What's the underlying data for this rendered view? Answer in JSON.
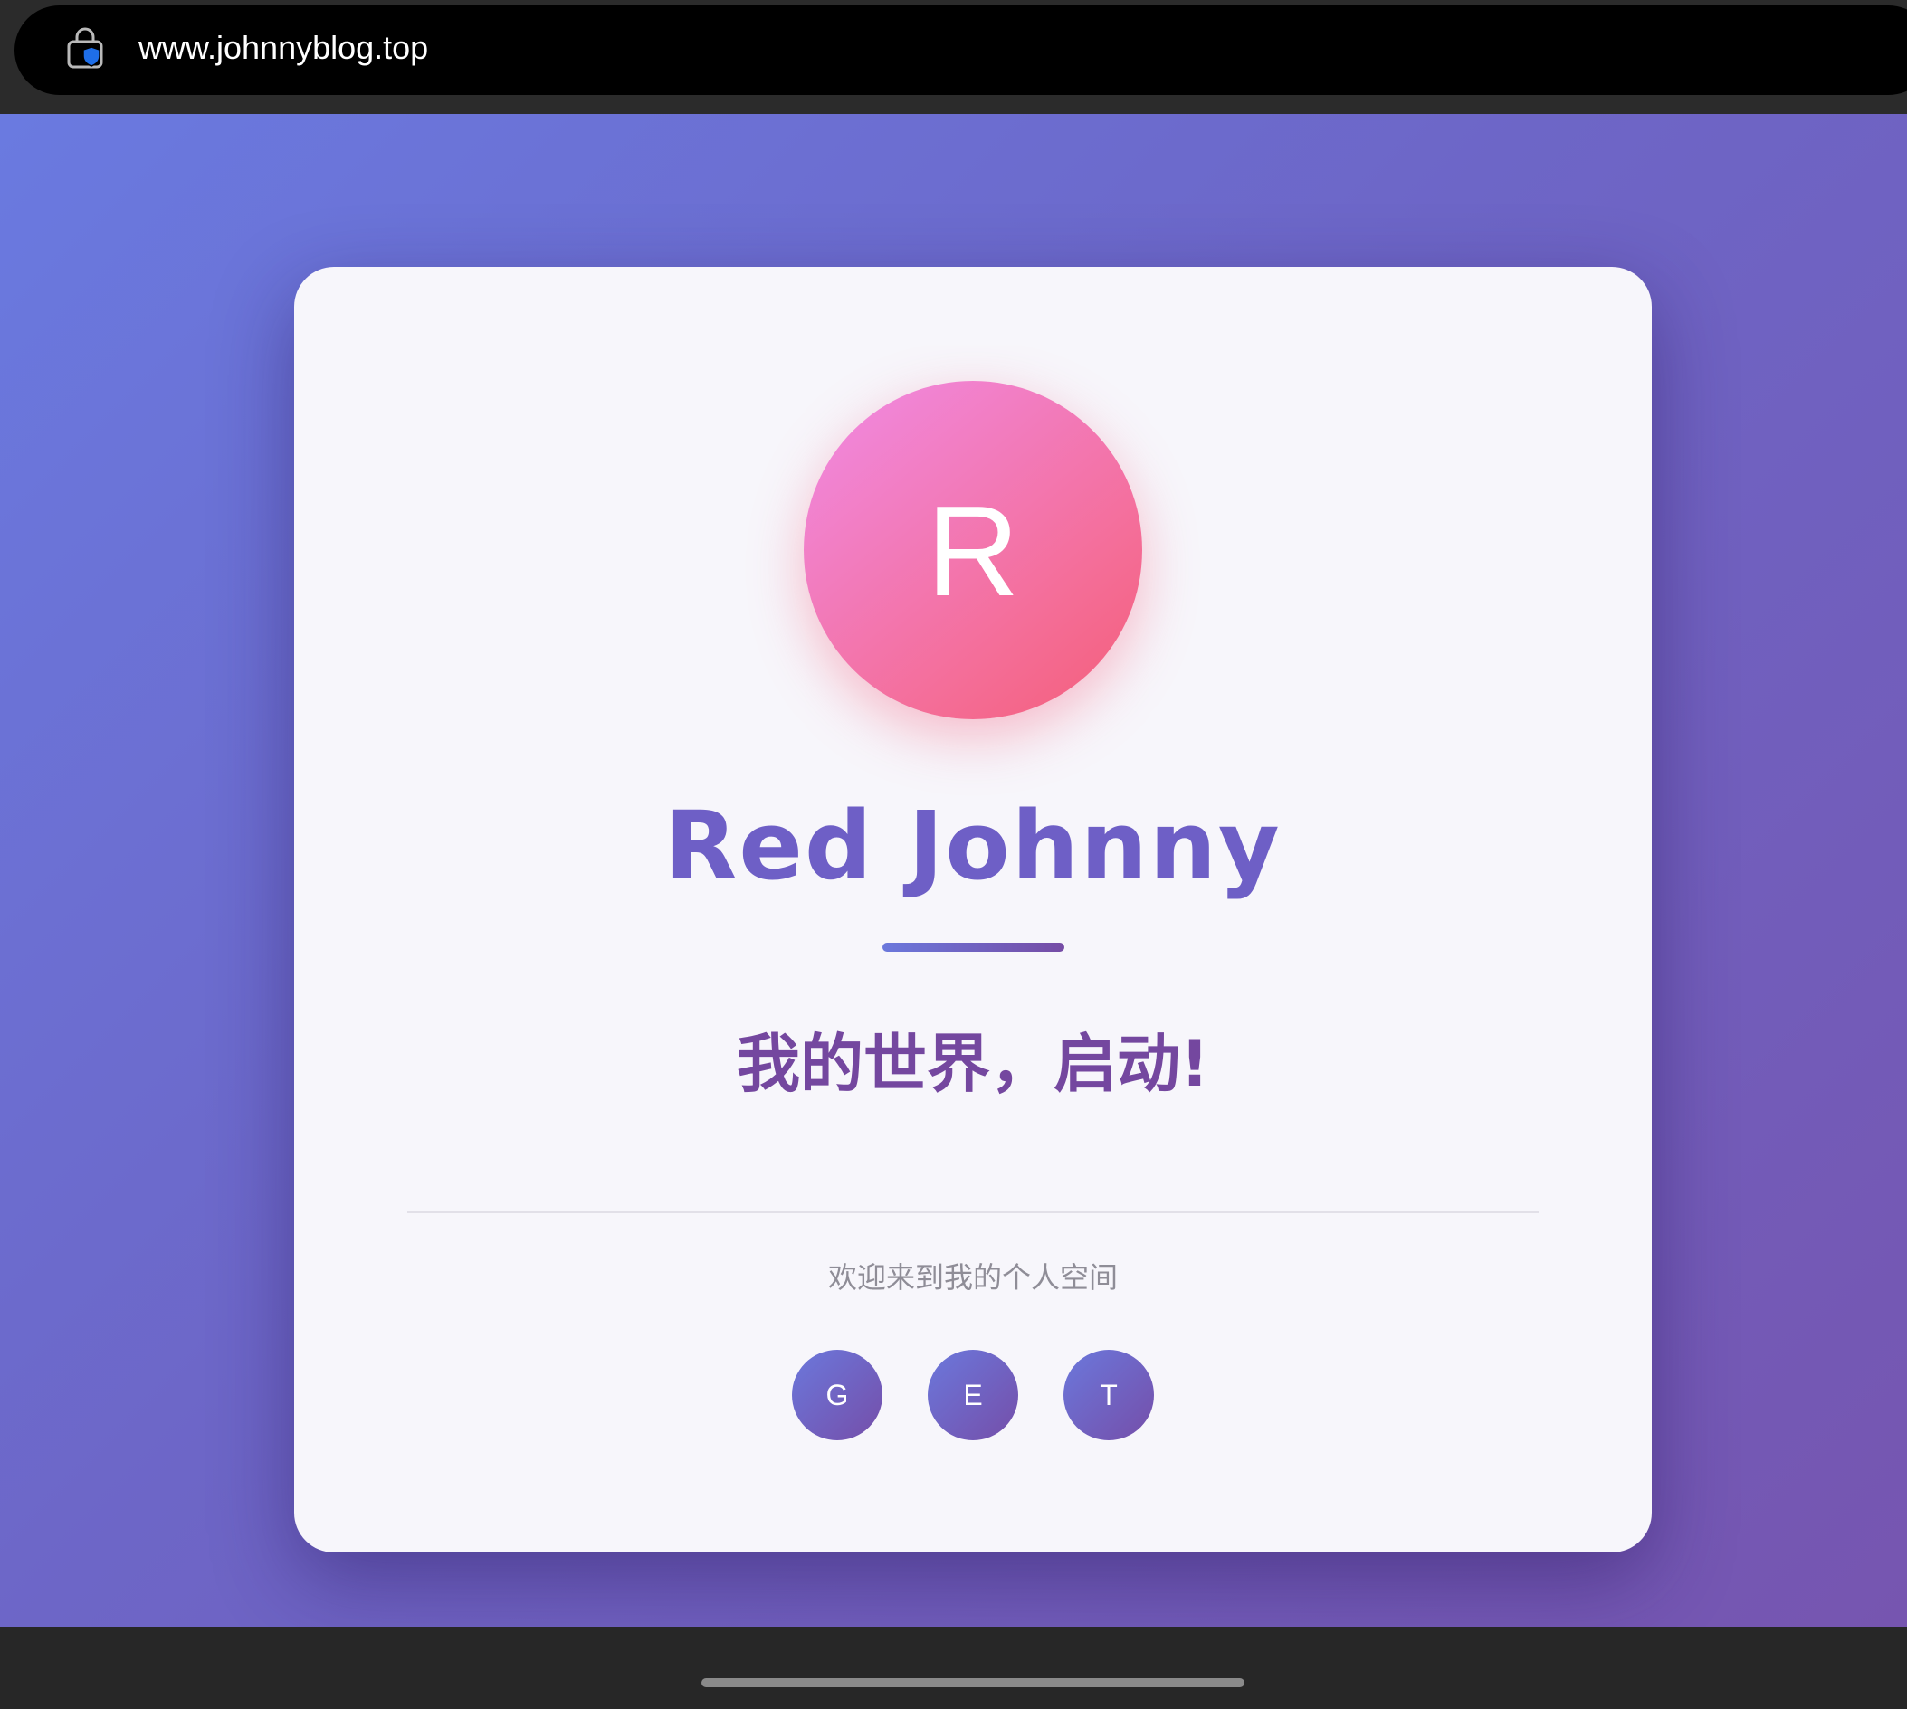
{
  "browser": {
    "url": "www.johnnyblog.top",
    "security_icon": "lock-shield-icon"
  },
  "profile": {
    "avatar_letter": "R",
    "name": "Red Johnny",
    "tagline": "我的世界，启动!",
    "welcome": "欢迎来到我的个人空间"
  },
  "social_buttons": [
    {
      "label": "G"
    },
    {
      "label": "E"
    },
    {
      "label": "T"
    }
  ],
  "colors": {
    "background_start": "#6a7ae0",
    "background_end": "#7655b0",
    "card": "#f7f6fb",
    "avatar_start": "#f08be6",
    "avatar_end": "#f55d78",
    "name_text": "#6e5fc6",
    "tagline_text": "#74479f",
    "welcome_text": "#8f8d97"
  }
}
